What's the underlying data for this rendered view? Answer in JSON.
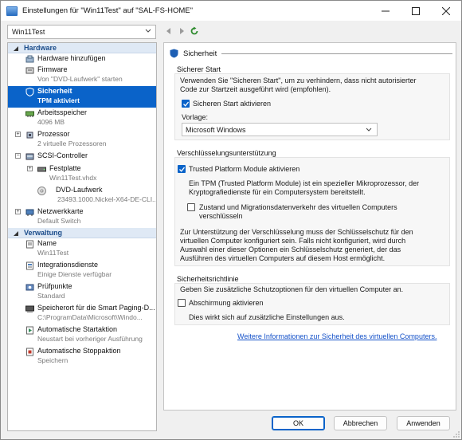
{
  "window": {
    "title": "Einstellungen für \"Win11Test\" auf \"SAL-FS-HOME\""
  },
  "vm_selector": {
    "value": "Win11Test"
  },
  "sidebar": {
    "hardware_header": "Hardware",
    "management_header": "Verwaltung",
    "hardware_items": [
      {
        "label": "Hardware hinzufügen",
        "sub": ""
      },
      {
        "label": "Firmware",
        "sub": "Von \"DVD-Laufwerk\" starten"
      },
      {
        "label": "Sicherheit",
        "sub": "TPM aktiviert"
      },
      {
        "label": "Arbeitsspeicher",
        "sub": "4096 MB"
      },
      {
        "label": "Prozessor",
        "sub": "2 virtuelle Prozessoren"
      },
      {
        "label": "SCSI-Controller",
        "sub": ""
      },
      {
        "label": "Festplatte",
        "sub": "Win11Test.vhdx"
      },
      {
        "label": "DVD-Laufwerk",
        "sub": "23493.1000.Nickel-X64-DE-CLI..."
      },
      {
        "label": "Netzwerkkarte",
        "sub": "Default Switch"
      }
    ],
    "management_items": [
      {
        "label": "Name",
        "sub": "Win11Test"
      },
      {
        "label": "Integrationsdienste",
        "sub": "Einige Dienste verfügbar"
      },
      {
        "label": "Prüfpunkte",
        "sub": "Standard"
      },
      {
        "label": "Speicherort für die Smart Paging-D...",
        "sub": "C:\\ProgramData\\Microsoft\\Windo..."
      },
      {
        "label": "Automatische Startaktion",
        "sub": "Neustart bei vorheriger Ausführung"
      },
      {
        "label": "Automatische Stoppaktion",
        "sub": "Speichern"
      }
    ]
  },
  "panel": {
    "header": "Sicherheit",
    "secure_boot": {
      "title": "Sicherer Start",
      "description_1": "Verwenden Sie \"Sicheren Start\", um zu verhindern, dass nicht autorisierter",
      "description_2": "Code zur Startzeit ausgeführt wird (empfohlen).",
      "checkbox_label": "Sicheren Start aktivieren",
      "checked": true,
      "template_label": "Vorlage:",
      "template_value": "Microsoft Windows"
    },
    "encryption": {
      "title": "Verschlüsselungsunterstützung",
      "tpm_label": "Trusted Platform Module aktivieren",
      "tpm_checked": true,
      "tpm_desc_1": "Ein TPM (Trusted Platform Module) ist ein spezieller Mikroprozessor, der",
      "tpm_desc_2": "Kryptografiedienste für ein Computersystem bereitstellt.",
      "migration_label_1": "Zustand und Migrationsdatenverkehr des virtuellen Computers",
      "migration_label_2": "verschlüsseln",
      "migration_checked": false,
      "note_1": "Zur Unterstützung der Verschlüsselung muss der Schlüsselschutz für den",
      "note_2": "virtuellen Computer konfiguriert sein. Falls nicht konfiguriert, wird durch",
      "note_3": "Auswahl einer dieser Optionen ein Schlüsselschutz generiert, der das",
      "note_4": "Ausführen des virtuellen Computers auf diesem Host ermöglicht."
    },
    "policy": {
      "title": "Sicherheitsrichtlinie",
      "description": "Geben Sie zusätzliche Schutzoptionen für den virtuellen Computer an.",
      "shielding_label": "Abschirmung aktivieren",
      "shielding_checked": false,
      "shielding_note": "Dies wirkt sich auf zusätzliche Einstellungen aus."
    },
    "more_info_link": "Weitere Informationen zur Sicherheit des virtuellen Computers."
  },
  "buttons": {
    "ok": "OK",
    "cancel": "Abbrechen",
    "apply": "Anwenden"
  },
  "colors": {
    "accent": "#0a63c9",
    "section_header_bg": "#dfe9f5",
    "link": "#1552c9"
  }
}
